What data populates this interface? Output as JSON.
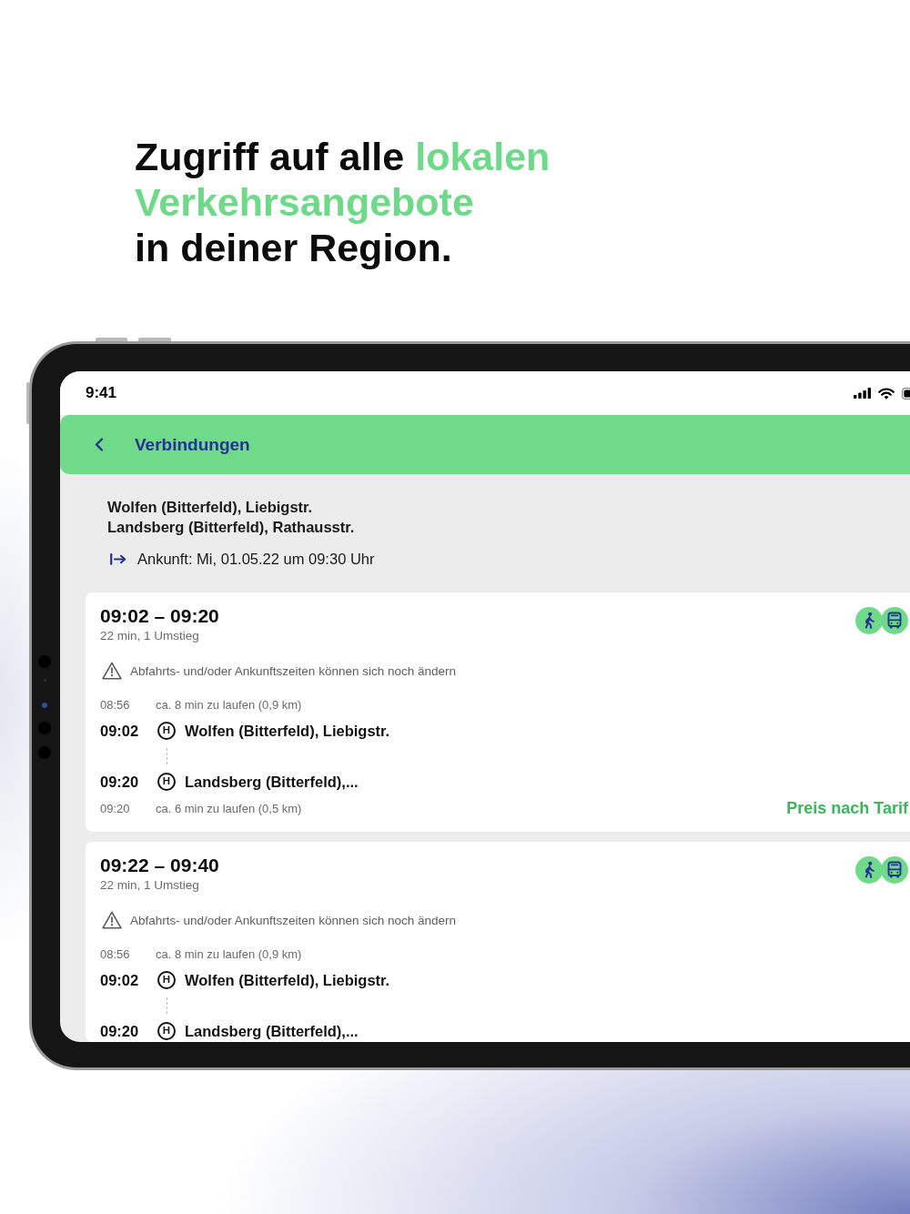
{
  "headline": {
    "lines": [
      [
        {
          "text": "Zugriff auf alle",
          "accent": false
        },
        {
          "text": "lokalen",
          "accent": true
        }
      ],
      [
        {
          "text": "Verkehrsangebote",
          "accent": true
        }
      ],
      [
        {
          "text": "in deiner Region.",
          "accent": false
        }
      ]
    ]
  },
  "status_bar": {
    "time": "9:41"
  },
  "header": {
    "title": "Verbindungen"
  },
  "route": {
    "from": "Wolfen (Bitterfeld), Liebigstr.",
    "to": "Landsberg (Bitterfeld), Rathausstr.",
    "arrival": "Ankunft: Mi, 01.05.22 um 09:30 Uhr"
  },
  "connections": [
    {
      "times": "09:02 – 09:20",
      "summary": "22 min, 1 Umstieg",
      "modes": [
        {
          "kind": "walk"
        },
        {
          "kind": "bus"
        }
      ],
      "notice": "Abfahrts- und/oder Ankunftszeiten können sich noch ändern",
      "legs": [
        {
          "kind": "walk",
          "time": "08:56",
          "text": "ca. 8 min zu laufen (0,9 km)"
        },
        {
          "kind": "stop",
          "time": "09:02",
          "symbol": "H",
          "name": "Wolfen (Bitterfeld), Liebigstr."
        },
        {
          "kind": "ride"
        },
        {
          "kind": "stop",
          "time": "09:20",
          "symbol": "H",
          "name": "Landsberg (Bitterfeld),..."
        },
        {
          "kind": "walk",
          "time": "09:20",
          "text": "ca. 6 min zu laufen (0,5 km)"
        }
      ],
      "price": "Preis nach Tarif"
    },
    {
      "times": "09:22 – 09:40",
      "summary": "22 min, 1 Umstieg",
      "modes": [
        {
          "kind": "walk"
        },
        {
          "kind": "bus"
        }
      ],
      "notice": "Abfahrts- und/oder Ankunftszeiten können sich noch ändern",
      "legs": [
        {
          "kind": "walk",
          "time": "08:56",
          "text": "ca. 8 min zu laufen (0,9 km)"
        },
        {
          "kind": "stop",
          "time": "09:02",
          "symbol": "H",
          "name": "Wolfen (Bitterfeld), Liebigstr."
        },
        {
          "kind": "ride"
        },
        {
          "kind": "stop",
          "time": "09:20",
          "symbol": "H",
          "name": "Landsberg (Bitterfeld),..."
        }
      ]
    }
  ]
}
